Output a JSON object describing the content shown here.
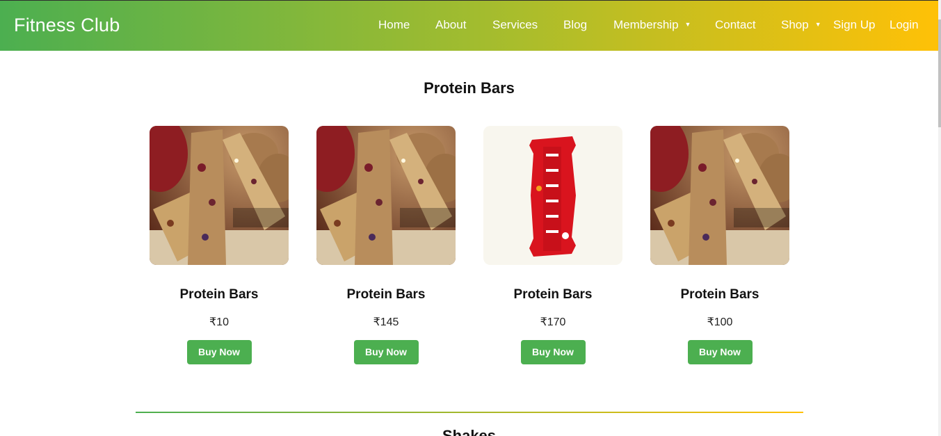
{
  "header": {
    "brand": "Fitness Club",
    "nav": {
      "home": "Home",
      "about": "About",
      "services": "Services",
      "blog": "Blog",
      "membership": "Membership",
      "contact": "Contact",
      "shop": "Shop",
      "signup": "Sign Up",
      "login": "Login"
    },
    "caret": "▼"
  },
  "section": {
    "title": "Protein Bars",
    "products": [
      {
        "name": "Protein Bars",
        "price": "₹10",
        "button": "Buy Now",
        "image": "granola-bar-photo"
      },
      {
        "name": "Protein Bars",
        "price": "₹145",
        "button": "Buy Now",
        "image": "granola-bar-photo"
      },
      {
        "name": "Protein Bars",
        "price": "₹170",
        "button": "Buy Now",
        "image": "aloha-bar-photo"
      },
      {
        "name": "Protein Bars",
        "price": "₹100",
        "button": "Buy Now",
        "image": "granola-bar-photo"
      }
    ]
  },
  "next_section": {
    "title": "Shakes"
  },
  "colors": {
    "gradient_start": "#4caf50",
    "gradient_end": "#ffc107",
    "button": "#4caf50"
  }
}
